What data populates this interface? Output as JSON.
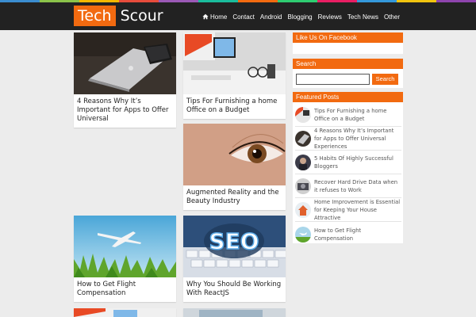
{
  "brand": {
    "part1": "Tech",
    "part2": "Scour"
  },
  "stripe_colors": [
    "#3b8dd0",
    "#8bc34a",
    "#f5b800",
    "#e74c3c",
    "#9b59b6",
    "#1abc9c",
    "#f26a10",
    "#2ecc71",
    "#e91e63",
    "#3498db",
    "#f1c40f",
    "#8e44ad"
  ],
  "colors": {
    "accent": "#f26a10",
    "header": "#222222",
    "background": "#ececec"
  },
  "nav": {
    "home_icon": "home-icon",
    "items": [
      "Home",
      "Contact",
      "Android",
      "Blogging",
      "Reviews",
      "Tech News",
      "Other"
    ]
  },
  "posts": [
    {
      "title": "4 Reasons Why It’s Important for Apps to Offer Universal",
      "image": "laptop-tablet-photo"
    },
    {
      "title": "Tips For Furnishing a home Office on a Budget",
      "image": "desk-office-photo"
    },
    {
      "title": "Augmented Reality and the Beauty Industry",
      "image": "eye-closeup-photo"
    },
    {
      "title": "How to Get Flight Compensation",
      "image": "airplane-grass-photo"
    },
    {
      "title": "Why You Should Be Working With ReactJS",
      "image": "seo-keyboard-photo"
    }
  ],
  "sidebar": {
    "facebook_title": "Like Us On Facebook",
    "search_title": "Search",
    "search_placeholder": "",
    "search_button": "Search",
    "featured_title": "Featured Posts",
    "featured": [
      "Tips For Furnishing a home Office on a Budget",
      "4 Reasons Why It’s Important for Apps to Offer Universal Experiences",
      "5 Habits Of Highly Successful Bloggers",
      "Recover Hard Drive Data when it refuses to Work",
      "Home Improvement is Essential for Keeping Your House Attractive",
      "How to Get Flight Compensation"
    ]
  }
}
